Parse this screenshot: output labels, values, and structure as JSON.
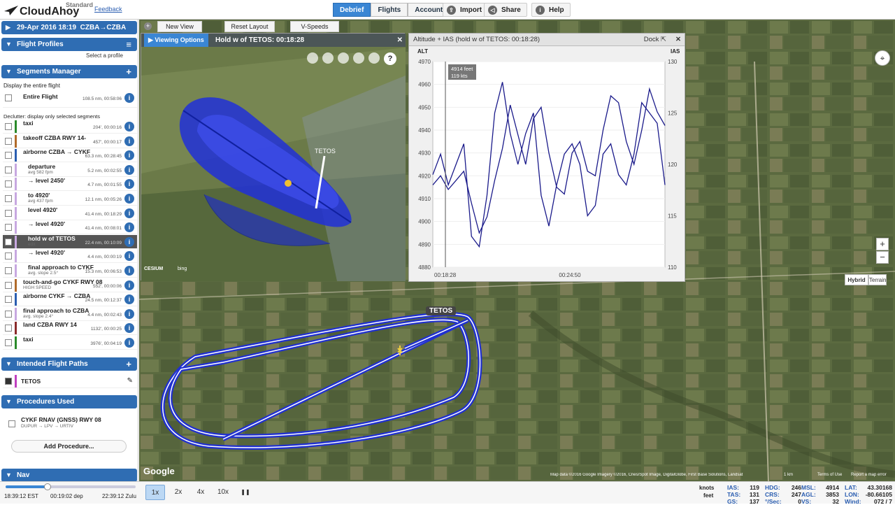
{
  "app": {
    "name": "CloudAhoy",
    "edition": "Standard",
    "feedback": "Feedback"
  },
  "nav": {
    "tabs": [
      "Debrief",
      "Flights",
      "Account"
    ],
    "active": "Debrief",
    "import": "Import",
    "share": "Share",
    "help": "Help"
  },
  "flight": {
    "date": "29-Apr 2016 18:19",
    "route": "CZBA→CZBA"
  },
  "flight_profiles": {
    "title": "Flight Profiles",
    "select": "Select a profile"
  },
  "segments": {
    "title": "Segments Manager",
    "display_all": "Display the entire flight",
    "entire": {
      "label": "Entire Flight",
      "meta": "108.5 nm, 00:58:06"
    },
    "declutter": "Declutter: display only selected segments",
    "items": [
      {
        "label": "taxi",
        "meta": "204', 00:00:16",
        "color": "#2a8a2a"
      },
      {
        "label": "takeoff CZBA RWY 14-",
        "meta": "457', 00:00:17",
        "color": "#b06a2a"
      },
      {
        "label": "airborne CZBA → CYKF",
        "meta": "63.3 nm, 00:28:45",
        "color": "#2a5db0"
      },
      {
        "label": "departure",
        "sub": "avg 582 fpm",
        "meta": "5.2 nm, 00:02:55",
        "color": "#c7a8e0"
      },
      {
        "label": "→ level 2450'",
        "meta": "4.7 nm, 00:01:55",
        "color": "#c7a8e0"
      },
      {
        "label": "to 4920'",
        "sub": "avg 437 fpm",
        "meta": "12.1 nm, 00:05:26",
        "color": "#c7a8e0"
      },
      {
        "label": "level 4920'",
        "meta": "41.4 nm, 00:18:29",
        "color": "#c7a8e0"
      },
      {
        "label": "→ level 4920'",
        "meta": "41.4 nm, 00:08:01",
        "color": "#c7a8e0"
      },
      {
        "label": "hold w of TETOS",
        "sub": "edit",
        "meta": "22.4 nm, 00:10:09",
        "color": "#c7a8e0",
        "selected": true
      },
      {
        "label": "→ level 4920'",
        "meta": "4.4 nm, 00:00:19",
        "color": "#c7a8e0"
      },
      {
        "label": "final approach to CYKF",
        "sub": "avg. slope 2.5°",
        "meta": "15.3 nm, 00:06:53",
        "color": "#c7a8e0"
      },
      {
        "label": "touch-and-go CYKF RWY 08",
        "sub": "HIGH SPEED",
        "meta": "552', 00:00:06",
        "color": "#b06a2a"
      },
      {
        "label": "airborne CYKF → CZBA",
        "meta": "24.5 nm, 00:12:37",
        "color": "#2a5db0"
      },
      {
        "label": "final approach to CZBA",
        "sub": "avg. slope 2.4°",
        "meta": "4.4 nm, 00:02:43",
        "color": "#c7a8e0"
      },
      {
        "label": "land CZBA RWY 14",
        "meta": "1132', 00:00:25",
        "color": "#8a2a2a"
      },
      {
        "label": "taxi",
        "meta": "3976', 00:04:19",
        "color": "#2a8a2a"
      }
    ]
  },
  "intended": {
    "title": "Intended Flight Paths",
    "item": "TETOS"
  },
  "procedures": {
    "title": "Procedures Used",
    "item": "CYKF RNAV (GNSS) RWY 08",
    "sub": "DUPUR → LPV → URTIV",
    "add": "Add Procedure..."
  },
  "nav_panel": {
    "title": "Nav"
  },
  "toolbar2": {
    "new_view": "New View",
    "reset": "Reset Layout",
    "vspeeds": "V-Speeds"
  },
  "view3d": {
    "options": "Viewing Options",
    "title": "Hold w of TETOS: 00:18:28",
    "fix": "TETOS",
    "credit": "CESIUM",
    "bing": "bing"
  },
  "chart": {
    "title": "Altitude + IAS (hold w of TETOS: 00:18:28)",
    "dock": "Dock",
    "left_label": "ALT",
    "right_label": "IAS",
    "tooltip_alt": "4914 feet",
    "tooltip_ias": "119 kts"
  },
  "chart_data": {
    "type": "line",
    "title": "Altitude + IAS (hold w of TETOS: 00:18:28)",
    "xlabel": "",
    "ylabel": "ALT",
    "x_ticks": [
      "00:18:28",
      "00:24:50"
    ],
    "ylim": [
      4880,
      4970
    ],
    "y_ticks": [
      4880,
      4890,
      4900,
      4910,
      4920,
      4930,
      4940,
      4950,
      4960,
      4970
    ],
    "y2lim": [
      110,
      130
    ],
    "y2_ticks": [
      110,
      115,
      120,
      125,
      130
    ],
    "series": [
      {
        "name": "ALT",
        "axis": "left",
        "color": "#1a1a8a",
        "values": [
          4916,
          4920,
          4914,
          4918,
          4922,
          4908,
          4895,
          4902,
          4918,
          4932,
          4951,
          4938,
          4925,
          4945,
          4950,
          4930,
          4915,
          4912,
          4930,
          4935,
          4922,
          4920,
          4940,
          4955,
          4952,
          4935,
          4925,
          4940,
          4958,
          4948,
          4942
        ]
      },
      {
        "name": "IAS",
        "axis": "right",
        "color": "#1a1a8a",
        "values": [
          119,
          121,
          118,
          120,
          122,
          113,
          112,
          117,
          125,
          128,
          123,
          120,
          123,
          125,
          117,
          114,
          118,
          121,
          122,
          120,
          115,
          116,
          121,
          122,
          119,
          118,
          121,
          126,
          125,
          124,
          118
        ]
      }
    ]
  },
  "map": {
    "fix": "TETOS",
    "google": "Google",
    "hybrid": "Hybrid",
    "terrain": "Terrain",
    "attribution": "Map data ©2016 Google Imagery ©2016, Cnes/Spot Image, DigitalGlobe, First Base Solutions, Landsat",
    "scale": "1 km",
    "terms": "Terms of Use",
    "report": "Report a map error"
  },
  "playback": {
    "start": "18:39:12 EST",
    "elapsed": "00:19:02 dep",
    "end": "22:39:12 Zulu",
    "speeds": [
      "1x",
      "2x",
      "4x",
      "10x"
    ],
    "active": "1x",
    "pause": "❚❚",
    "progress": 0.32
  },
  "units": {
    "speed": "knots",
    "alt": "feet"
  },
  "telemetry": {
    "ias": {
      "k": "IAS:",
      "v": "119"
    },
    "tas": {
      "k": "TAS:",
      "v": "131"
    },
    "gs": {
      "k": "GS:",
      "v": "137"
    },
    "hdg": {
      "k": "HDG:",
      "v": "246"
    },
    "crs": {
      "k": "CRS:",
      "v": "247"
    },
    "vsec": {
      "k": "°/Sec:",
      "v": "0"
    },
    "msl": {
      "k": "MSL:",
      "v": "4914"
    },
    "agl": {
      "k": "AGL:",
      "v": "3853"
    },
    "vs": {
      "k": "VS:",
      "v": "32"
    },
    "lat": {
      "k": "LAT:",
      "v": "43.30168"
    },
    "lon": {
      "k": "LON:",
      "v": "-80.66105"
    },
    "wind": {
      "k": "Wind:",
      "v": "072 / 7"
    }
  }
}
